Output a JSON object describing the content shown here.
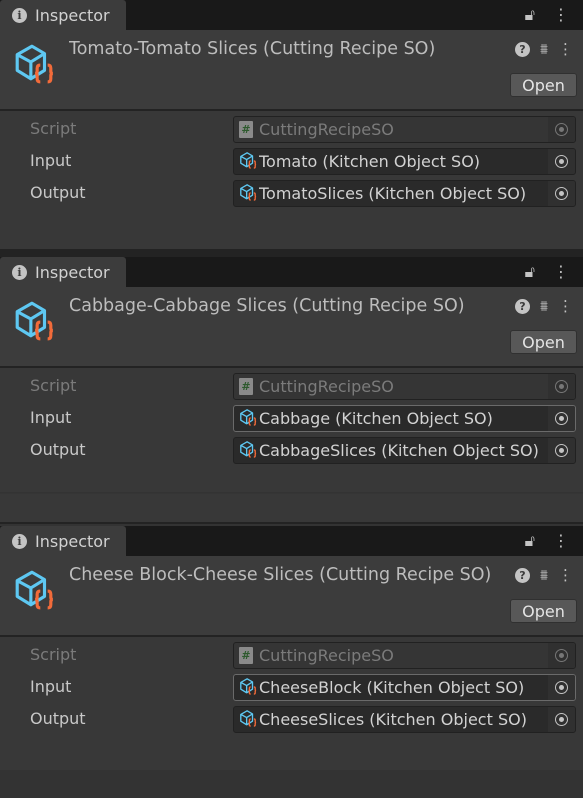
{
  "colors": {
    "accent_cube": "#5ec8f2",
    "accent_braces": "#f26b3a"
  },
  "panels": [
    {
      "tab_label": "Inspector",
      "title": "Tomato-Tomato Slices (Cutting Recipe SO)",
      "open_label": "Open",
      "fields": [
        {
          "label": "Script",
          "value": "CuttingRecipeSO"
        },
        {
          "label": "Input",
          "value": "Tomato (Kitchen Object SO)"
        },
        {
          "label": "Output",
          "value": "TomatoSlices (Kitchen Object SO)"
        }
      ]
    },
    {
      "tab_label": "Inspector",
      "title": "Cabbage-Cabbage Slices (Cutting Recipe SO)",
      "open_label": "Open",
      "fields": [
        {
          "label": "Script",
          "value": "CuttingRecipeSO"
        },
        {
          "label": "Input",
          "value": "Cabbage (Kitchen Object SO)"
        },
        {
          "label": "Output",
          "value": "CabbageSlices (Kitchen Object SO)"
        }
      ]
    },
    {
      "tab_label": "Inspector",
      "title": "Cheese Block-Cheese Slices (Cutting Recipe SO)",
      "open_label": "Open",
      "fields": [
        {
          "label": "Script",
          "value": "CuttingRecipeSO"
        },
        {
          "label": "Input",
          "value": "CheeseBlock (Kitchen Object SO)"
        },
        {
          "label": "Output",
          "value": "CheeseSlices (Kitchen Object SO)"
        }
      ]
    }
  ]
}
